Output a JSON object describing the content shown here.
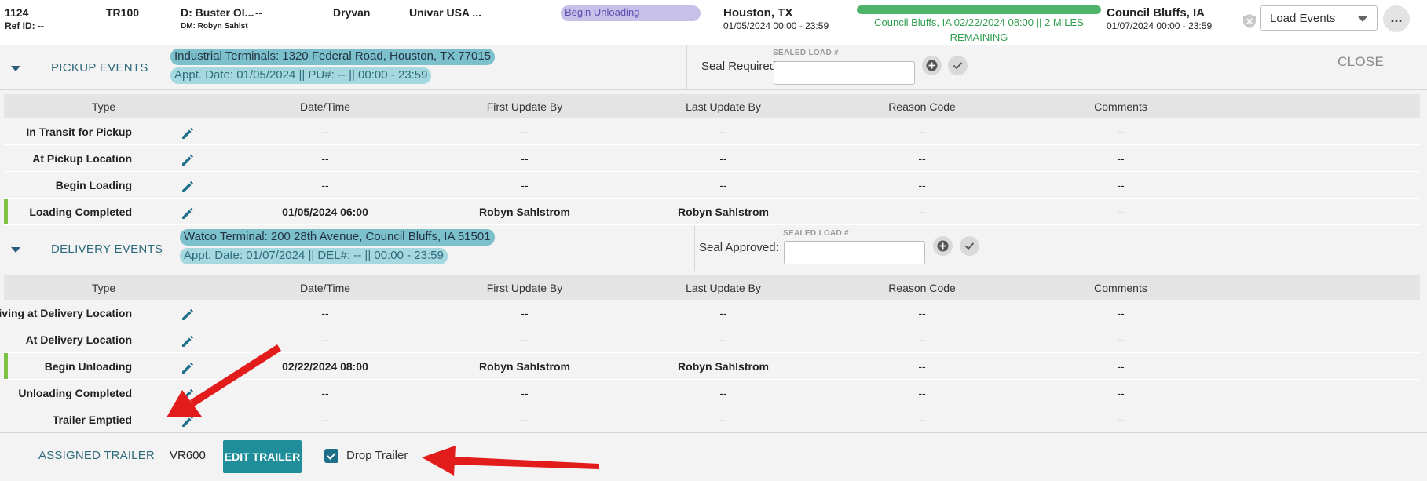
{
  "load": {
    "id": "1124",
    "ref_id": "Ref ID: --",
    "truck": "TR100",
    "driver": "D: Buster Ol...",
    "driver_extra": "--",
    "dm": "DM: Robyn Sahlst",
    "equipment": "Dryvan",
    "customer": "Univar USA ...",
    "status": "Begin Unloading",
    "origin_city": "Houston, TX",
    "origin_window": "01/05/2024 00:00 - 23:59",
    "progress_text_1": "Council Bluffs, IA 02/22/2024 08:00 || 2 MILES",
    "progress_text_2": "REMAINING",
    "progress_fraction": 1.0,
    "dest_city": "Council Bluffs, IA",
    "dest_window": "01/07/2024 00:00 - 23:59",
    "load_events_select": "Load Events",
    "more_icon": "..."
  },
  "pickup": {
    "title": "PICKUP EVENTS",
    "address": "Industrial Terminals: 1320 Federal Road, Houston, TX 77015",
    "appt": "Appt. Date: 01/05/2024 || PU#: -- || 00:00 - 23:59",
    "seal_label": "Seal Required:",
    "sealed_caption": "SEALED LOAD #",
    "seal_value": "",
    "close_label": "CLOSE"
  },
  "delivery": {
    "title": "DELIVERY EVENTS",
    "address": "Watco Terminal: 200 28th Avenue, Council Bluffs, IA 51501",
    "appt": "Appt. Date: 01/07/2024 || DEL#: -- || 00:00 - 23:59",
    "seal_label": "Seal Approved:",
    "sealed_caption": "SEALED LOAD #",
    "seal_value": ""
  },
  "columns": {
    "type": "Type",
    "datetime": "Date/Time",
    "first": "First Update By",
    "last": "Last Update By",
    "reason": "Reason Code",
    "comments": "Comments"
  },
  "pickup_rows": [
    {
      "type": "In Transit for Pickup",
      "datetime": "--",
      "first": "--",
      "last": "--",
      "reason": "--",
      "comments": "--"
    },
    {
      "type": "At Pickup Location",
      "datetime": "--",
      "first": "--",
      "last": "--",
      "reason": "--",
      "comments": "--"
    },
    {
      "type": "Begin Loading",
      "datetime": "--",
      "first": "--",
      "last": "--",
      "reason": "--",
      "comments": "--"
    },
    {
      "type": "Loading Completed",
      "datetime": "01/05/2024 06:00",
      "first": "Robyn Sahlstrom",
      "last": "Robyn Sahlstrom",
      "reason": "--",
      "comments": "--"
    }
  ],
  "delivery_rows": [
    {
      "type": "Arriving at Delivery Location",
      "datetime": "--",
      "first": "--",
      "last": "--",
      "reason": "--",
      "comments": "--"
    },
    {
      "type": "At Delivery Location",
      "datetime": "--",
      "first": "--",
      "last": "--",
      "reason": "--",
      "comments": "--"
    },
    {
      "type": "Begin Unloading",
      "datetime": "02/22/2024 08:00",
      "first": "Robyn Sahlstrom",
      "last": "Robyn Sahlstrom",
      "reason": "--",
      "comments": "--"
    },
    {
      "type": "Unloading Completed",
      "datetime": "--",
      "first": "--",
      "last": "--",
      "reason": "--",
      "comments": "--"
    },
    {
      "type": "Trailer Emptied",
      "datetime": "--",
      "first": "--",
      "last": "--",
      "reason": "--",
      "comments": "--"
    }
  ],
  "trailer": {
    "assigned_label": "ASSIGNED TRAILER",
    "value": "VR600",
    "edit_label": "EDIT TRAILER",
    "drop_label": "Drop Trailer",
    "drop_checked": true
  },
  "colors": {
    "teal": "#2d6a7b",
    "button": "#1f8e9a",
    "status_pill": "#c7c0e8",
    "progress": "#4fb36a",
    "row_marker": "#7dc242",
    "arrow": "#e21b1b"
  }
}
